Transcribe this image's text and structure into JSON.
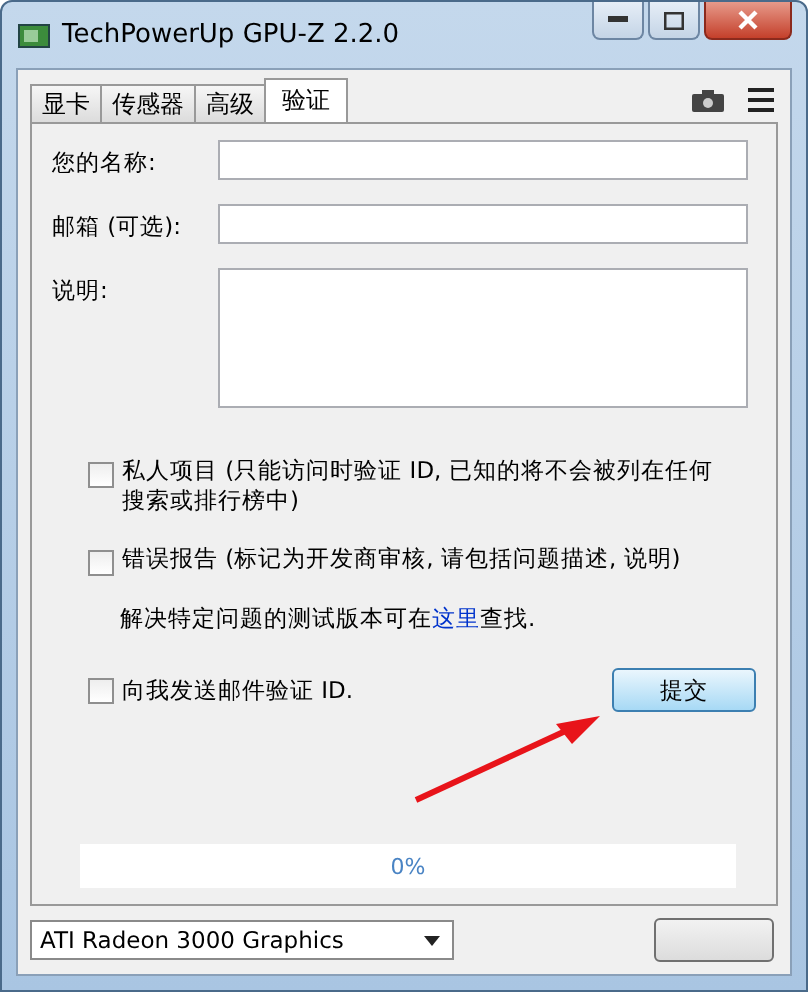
{
  "window": {
    "title": "TechPowerUp GPU-Z 2.2.0"
  },
  "tabs": [
    {
      "label": "显卡",
      "selected": false
    },
    {
      "label": "传感器",
      "selected": false
    },
    {
      "label": "高级",
      "selected": false
    },
    {
      "label": "验证",
      "selected": true
    }
  ],
  "form": {
    "fields": [
      {
        "label": "您的名称:",
        "kind": "input"
      },
      {
        "label": "邮箱 (可选):",
        "kind": "input"
      },
      {
        "label": "说明:",
        "kind": "textarea"
      }
    ],
    "options": [
      {
        "label": "私人项目 (只能访问时验证 ID, 已知的将不会被列在任何搜索或排行榜中)",
        "checked": false
      },
      {
        "label": "错误报告 (标记为开发商审核, 请包括问题描述, 说明)",
        "checked": false
      }
    ],
    "note": {
      "before": "解决特定问题的测试版本可在",
      "link": "这里",
      "after": "查找."
    },
    "email_option": {
      "label": "向我发送邮件验证 ID.",
      "checked": false
    },
    "submit": "提交"
  },
  "progress": {
    "level": 0,
    "reading": "0%"
  },
  "device_select": {
    "value": "ATI Radeon 3000 Graphics"
  }
}
